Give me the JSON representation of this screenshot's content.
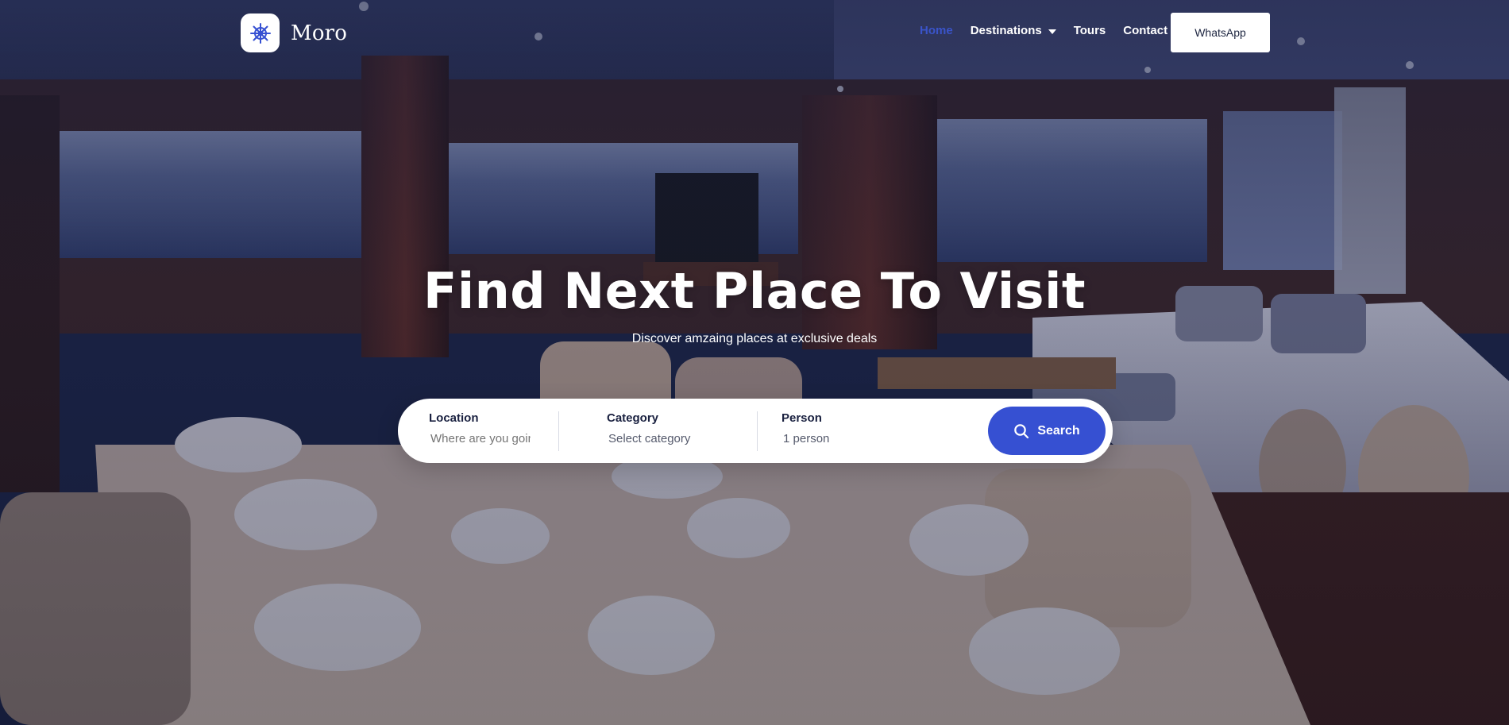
{
  "brand": {
    "name": "Moro",
    "logo_icon": "ship-wheel-icon"
  },
  "nav": {
    "items": [
      {
        "label": "Home",
        "active": true
      },
      {
        "label": "Destinations",
        "has_dropdown": true
      },
      {
        "label": "Tours"
      },
      {
        "label": "Contact"
      }
    ],
    "cta_label": "WhatsApp"
  },
  "hero": {
    "title": "Find Next Place To Visit",
    "subtitle": "Discover amzaing places at exclusive deals"
  },
  "search": {
    "location": {
      "label": "Location",
      "placeholder": "Where are you going?"
    },
    "category": {
      "label": "Category",
      "value": "Select category"
    },
    "person": {
      "label": "Person",
      "value": "1 person"
    },
    "button_label": "Search",
    "button_icon": "search-icon"
  },
  "colors": {
    "accent": "#3650d2",
    "active_link": "#3a54c9",
    "overlay": "#161c3a",
    "text_dark": "#1a2140"
  }
}
